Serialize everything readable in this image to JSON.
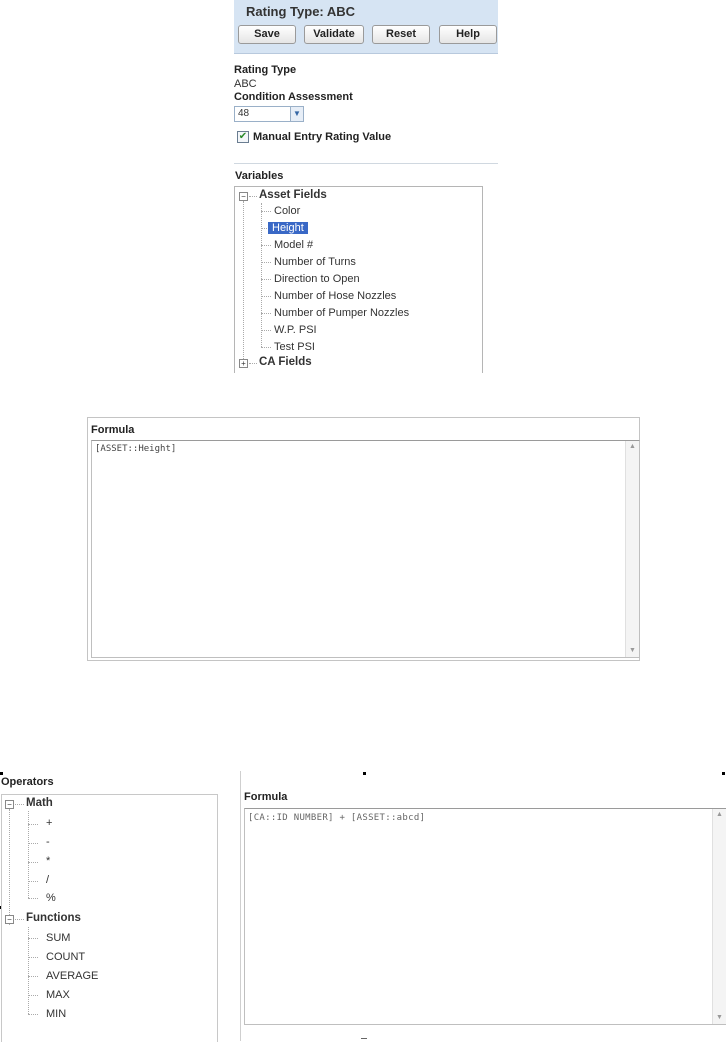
{
  "header": {
    "title": "Rating Type: ABC",
    "buttons": {
      "save": "Save",
      "validate": "Validate",
      "reset": "Reset",
      "help": "Help"
    }
  },
  "form": {
    "rating_type_label": "Rating Type",
    "rating_type_value": "ABC",
    "condition_label": "Condition Assessment",
    "condition_value": "48",
    "manual_entry_label": "Manual Entry Rating Value",
    "manual_entry_checked": true
  },
  "variables": {
    "title": "Variables",
    "tree": {
      "asset_fields": {
        "label": "Asset Fields",
        "expander": "−",
        "items": [
          "Color",
          "Height",
          "Model #",
          "Number of Turns",
          "Direction to Open",
          "Number of Hose Nozzles",
          "Number of Pumper Nozzles",
          "W.P. PSI",
          "Test PSI"
        ],
        "selected": "Height"
      },
      "ca_fields": {
        "label": "CA Fields",
        "expander": "+"
      }
    }
  },
  "formula_panel": {
    "title": "Formula",
    "value": "[ASSET::Height]"
  },
  "operators": {
    "title": "Operators",
    "math": {
      "label": "Math",
      "expander": "−",
      "items": [
        "+",
        "-",
        "*",
        "/",
        "%"
      ]
    },
    "functions": {
      "label": "Functions",
      "expander": "−",
      "items": [
        "SUM",
        "COUNT",
        "AVERAGE",
        "MAX",
        "MIN"
      ]
    }
  },
  "formula_panel_2": {
    "title": "Formula",
    "value": "[CA::ID NUMBER] + [ASSET::abcd]"
  },
  "scrollbar": {
    "up": "▲",
    "down": "▼"
  },
  "checkmark": "✔",
  "dropdown_arrow": "▼",
  "colors": {
    "header_bg": "#d6e4f3",
    "selection": "#3968c6"
  }
}
